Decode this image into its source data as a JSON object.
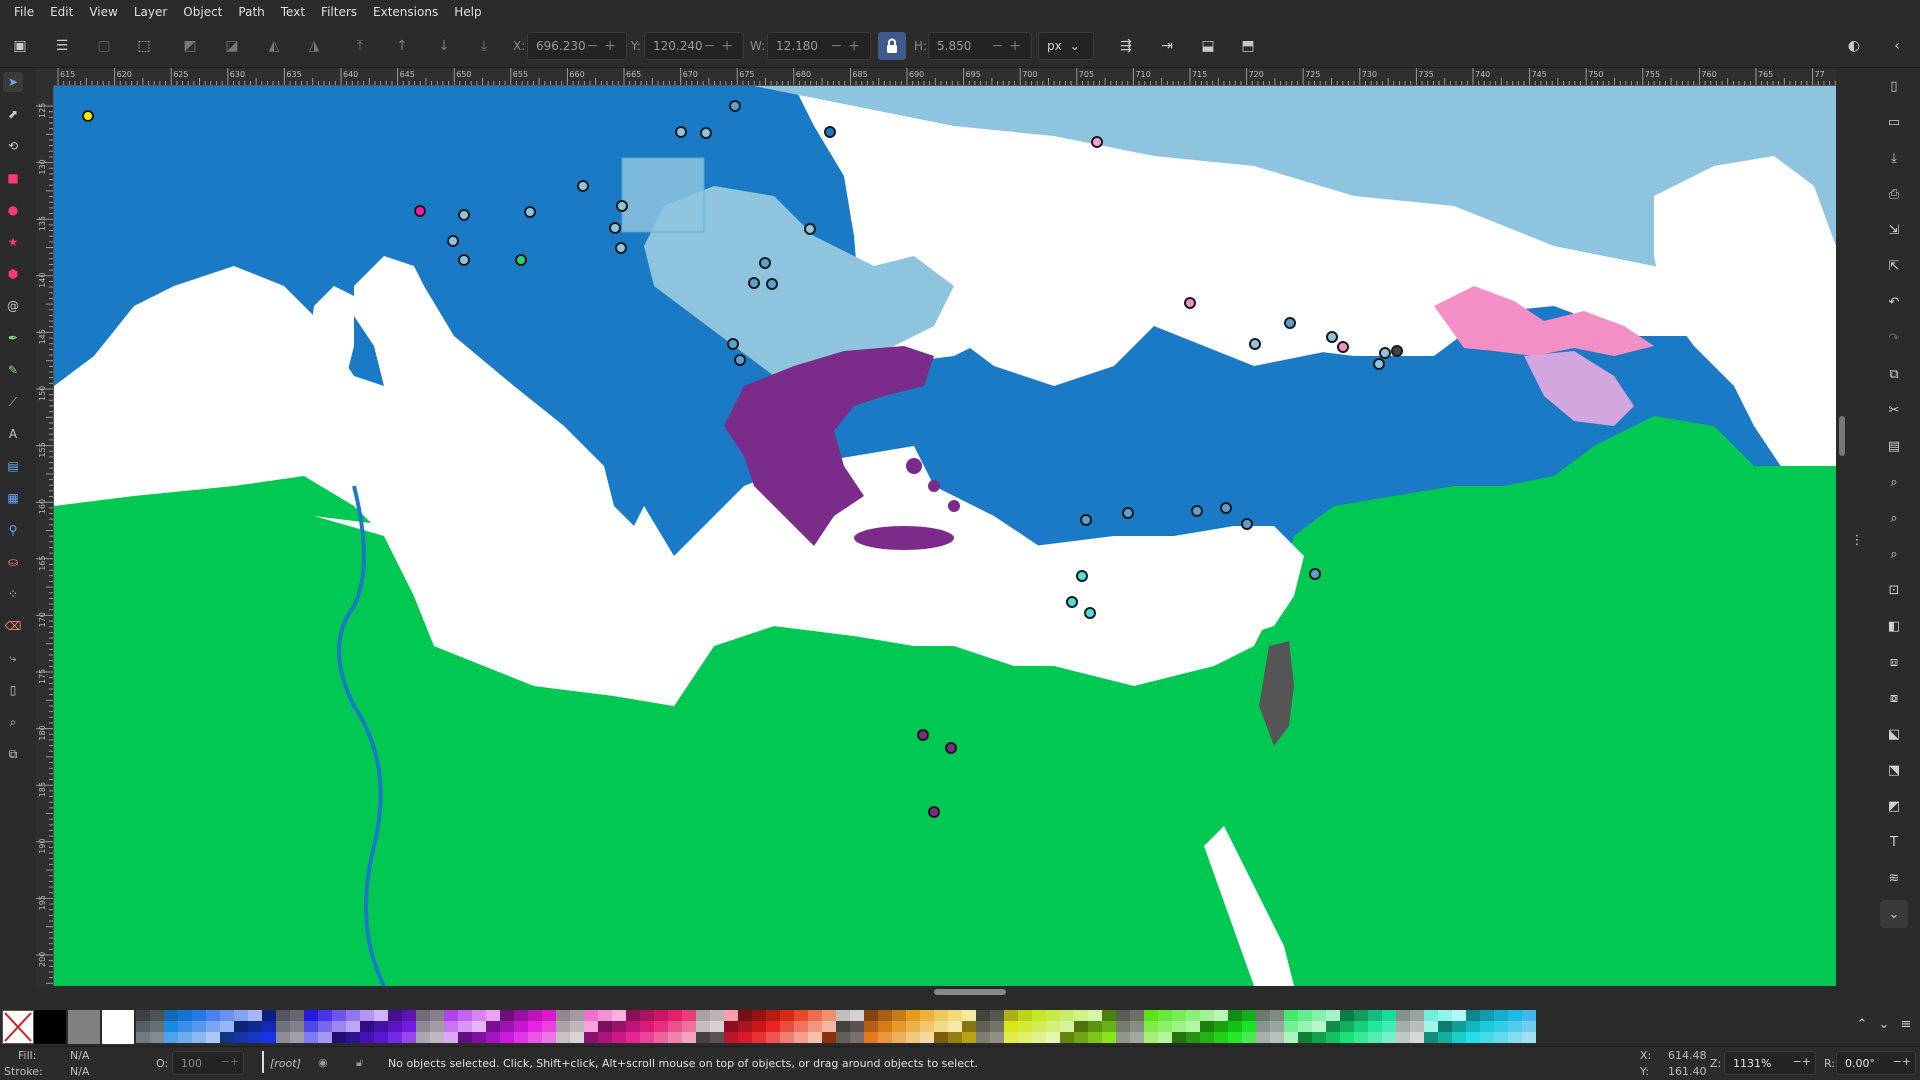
{
  "menu": [
    "File",
    "Edit",
    "View",
    "Layer",
    "Object",
    "Path",
    "Text",
    "Filters",
    "Extensions",
    "Help"
  ],
  "toolbar": {
    "x_label": "X:",
    "x_value": "696.230",
    "y_label": "Y:",
    "y_value": "120.240",
    "w_label": "W:",
    "w_value": "12.180",
    "h_label": "H:",
    "h_value": "5.850",
    "unit": "px"
  },
  "ruler_top": [
    "615",
    "620",
    "625",
    "630",
    "635",
    "640",
    "645",
    "650",
    "655",
    "660",
    "665",
    "670",
    "675",
    "680",
    "685",
    "690",
    "695",
    "700",
    "705",
    "710",
    "715",
    "720",
    "725",
    "730",
    "735",
    "740",
    "745",
    "750",
    "755",
    "760",
    "765",
    "77"
  ],
  "ruler_left": [
    "125",
    "130",
    "135",
    "140",
    "145",
    "150",
    "155",
    "160",
    "165",
    "170",
    "175",
    "180",
    "185",
    "190",
    "195",
    "200"
  ],
  "colors": {
    "sea": "#1b7ac6",
    "land_light": "#8fc4df",
    "land_white": "#ffffff",
    "land_green": "#00c853",
    "greece_purple": "#7b2b8a",
    "georgia_pink": "#f48fc6",
    "armenia_lilac": "#d4a6e0",
    "israel_gray": "#555555"
  },
  "status": {
    "fill_label": "Fill:",
    "fill_value": "N/A",
    "stroke_label": "Stroke:",
    "stroke_value": "N/A",
    "opacity_label": "O:",
    "opacity_value": "100",
    "layer": "[root]",
    "message": "No objects selected. Click, Shift+click, Alt+scroll mouse on top of objects, or drag around objects to select.",
    "cursor_x_label": "X:",
    "cursor_x": "614.48",
    "cursor_y_label": "Y:",
    "cursor_y": "161.40",
    "zoom_label": "Z:",
    "zoom": "1131%",
    "rotate_label": "R:",
    "rotate": "0.00°"
  }
}
